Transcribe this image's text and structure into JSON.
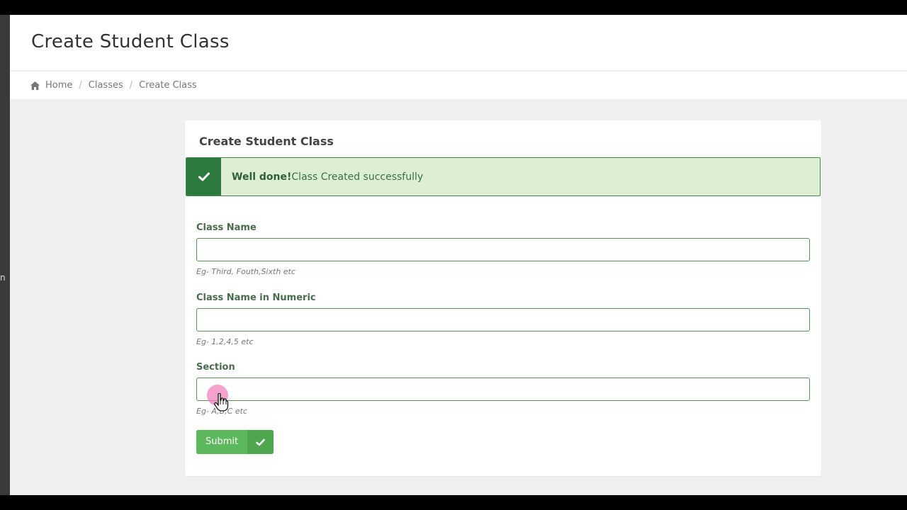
{
  "sidebar": {
    "peek_char": "n"
  },
  "header": {
    "title": "Create Student Class"
  },
  "breadcrumb": {
    "home": "Home",
    "classes": "Classes",
    "current": "Create Class",
    "separator": "/"
  },
  "card": {
    "title": "Create Student Class",
    "alert": {
      "strong": "Well done!",
      "message": "Class Created successfully"
    },
    "fields": [
      {
        "label": "Class Name",
        "value": "",
        "help": "Eg- Third, Fouth,Sixth etc"
      },
      {
        "label": "Class Name in Numeric",
        "value": "",
        "help": "Eg- 1,2,4,5 etc"
      },
      {
        "label": "Section",
        "value": "",
        "help": "Eg- A,B,C etc"
      }
    ],
    "submit_label": "Submit"
  },
  "colors": {
    "success_dark": "#2c7a3e",
    "success_light": "#dcefd4",
    "button": "#5cb85c",
    "input_border": "#55915c"
  },
  "icons": {
    "home": "home-icon",
    "alert": "check-icon",
    "submit": "check-icon"
  }
}
